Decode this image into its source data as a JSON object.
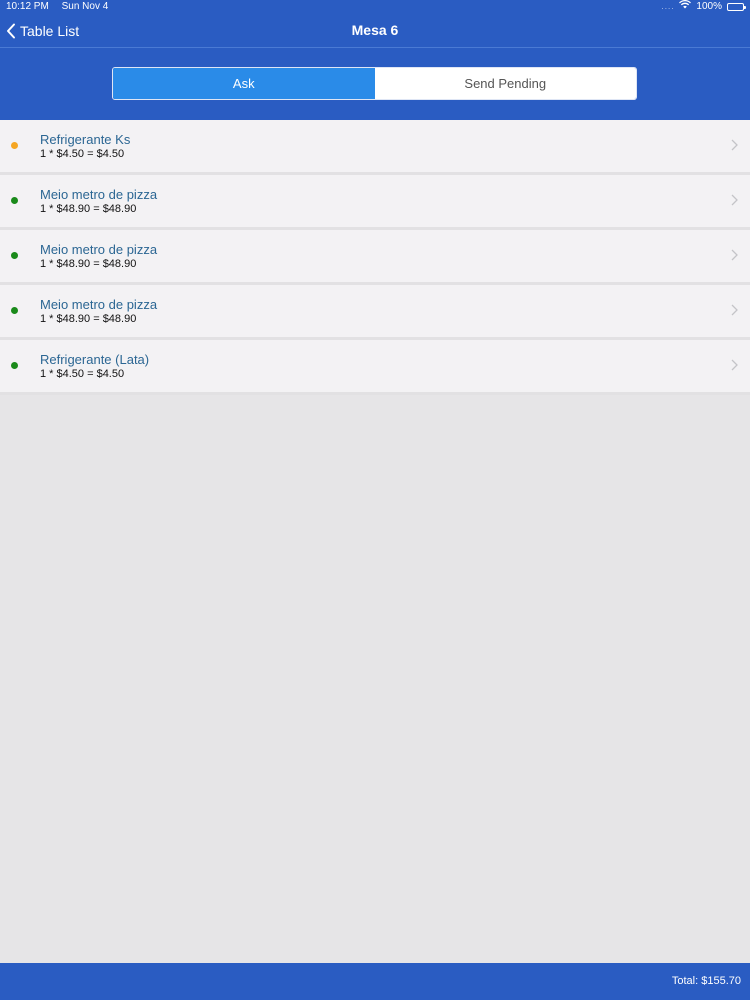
{
  "status_bar": {
    "time": "10:12 PM",
    "date": "Sun Nov 4",
    "battery": "100%"
  },
  "nav": {
    "back_label": "Table List",
    "title": "Mesa 6"
  },
  "segments": {
    "ask": "Ask",
    "send_pending": "Send Pending",
    "selected": "ask"
  },
  "orders": [
    {
      "name": "Refrigerante Ks",
      "calc": "1 * $4.50 = $4.50",
      "status_color": "#f5a623"
    },
    {
      "name": "Meio metro de pizza",
      "calc": "1 * $48.90 = $48.90",
      "status_color": "#1a8a1a"
    },
    {
      "name": "Meio metro de pizza",
      "calc": "1 * $48.90 = $48.90",
      "status_color": "#1a8a1a"
    },
    {
      "name": "Meio metro de pizza",
      "calc": "1 * $48.90 = $48.90",
      "status_color": "#1a8a1a"
    },
    {
      "name": "Refrigerante (Lata)",
      "calc": "1 * $4.50 = $4.50",
      "status_color": "#1a8a1a"
    }
  ],
  "footer": {
    "total": "Total: $155.70"
  },
  "colors": {
    "brand_blue": "#2a5cc2",
    "segment_active": "#2a8be8",
    "item_name": "#2b6693"
  },
  "icons": {
    "back": "chevron-left-icon",
    "row": "chevron-right-icon",
    "wifi": "wifi-icon",
    "battery": "battery-icon"
  }
}
